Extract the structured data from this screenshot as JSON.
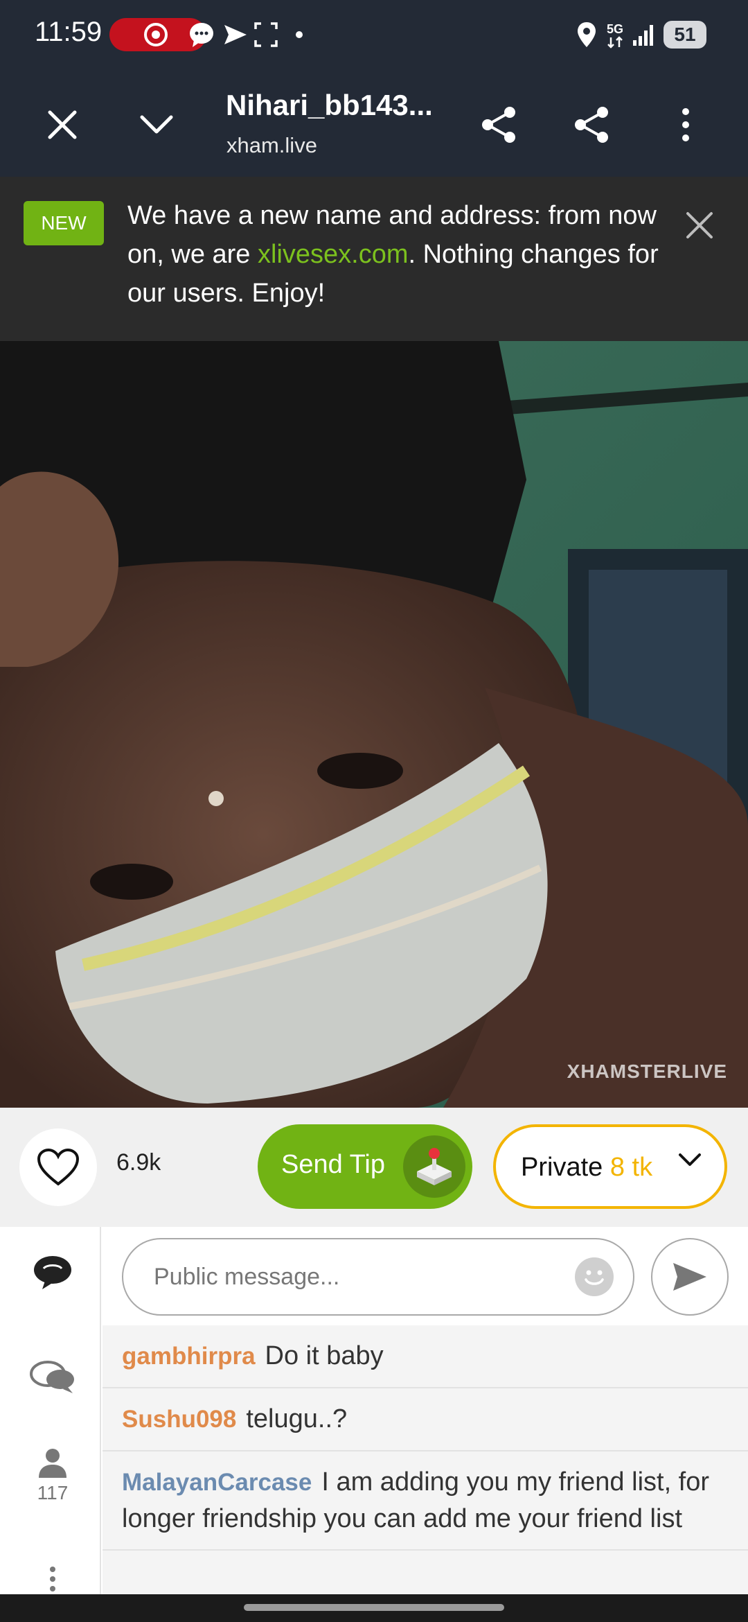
{
  "status_bar": {
    "time": "11:59",
    "battery": "51",
    "network": "5G",
    "icons": [
      "screen-record-icon",
      "chat-bubble-icon",
      "send-plane-icon",
      "screenshot-frame-icon",
      "dot-icon",
      "location-icon",
      "network-5g-icon",
      "signal-icon",
      "battery-icon"
    ]
  },
  "toolbar": {
    "title": "Nihari_bb143...",
    "subtitle": "xham.live",
    "icons": [
      "close-icon",
      "chevron-down-icon",
      "share-icon",
      "share-icon",
      "more-vertical-icon"
    ]
  },
  "banner": {
    "badge": "NEW",
    "text_before": "We have a new name and address: from now on, we are ",
    "link": "xlivesex.com",
    "text_after": ". Nothing changes for our users. Enjoy!"
  },
  "video": {
    "watermark": "XHAMSTERLIVE"
  },
  "actions": {
    "likes": "6.9k",
    "tip_label": "Send Tip",
    "private_label": "Private",
    "private_price": "8 tk"
  },
  "chat": {
    "placeholder": "Public message...",
    "viewer_count": "117",
    "messages": [
      {
        "user": "gambhirpra",
        "text": "Do it baby",
        "color": "#e08a4a"
      },
      {
        "user": "Sushu098",
        "text": "telugu..?",
        "color": "#e08a4a"
      },
      {
        "user": "MalayanCarcase",
        "text": "I am adding you my friend list, for longer friendship you can add me your friend list",
        "color": "#6b8bb0"
      }
    ]
  },
  "colors": {
    "toolbar_bg": "#232a36",
    "accent_green": "#71b314",
    "link_green": "#7cc11e",
    "private_yellow": "#f3b400",
    "record_red": "#c4121e"
  }
}
